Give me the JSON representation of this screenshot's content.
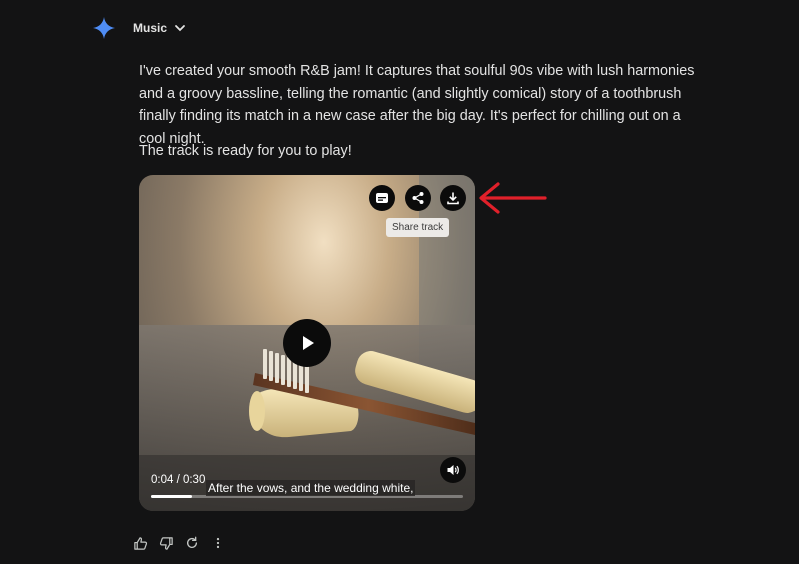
{
  "header": {
    "model_label": "Music"
  },
  "message": {
    "paragraphs": [
      "I've created your smooth R&B jam! It captures that soulful 90s vibe with lush harmonies and a groovy bassline, telling the romantic (and slightly comical) story of a toothbrush finally finding its match in a new case after the big day. It's perfect for chilling out on a cool night.",
      "The track is ready for you to play!"
    ]
  },
  "player": {
    "tooltip": "Share track",
    "time": "0:04 / 0:30",
    "caption": "After the vows, and the wedding white,",
    "progress": 0.133
  },
  "colors": {
    "background": "#131314",
    "text": "#e3e3e3",
    "gemini_blue": "#4f8df5",
    "annotation_red": "#e0202a"
  },
  "icons": {
    "captions": "captions-icon",
    "share": "share-icon",
    "download": "download-icon",
    "play": "play-icon",
    "volume": "volume-icon",
    "thumbs_up": "thumbs-up-icon",
    "thumbs_down": "thumbs-down-icon",
    "regenerate": "regenerate-icon",
    "more": "more-vert-icon"
  }
}
